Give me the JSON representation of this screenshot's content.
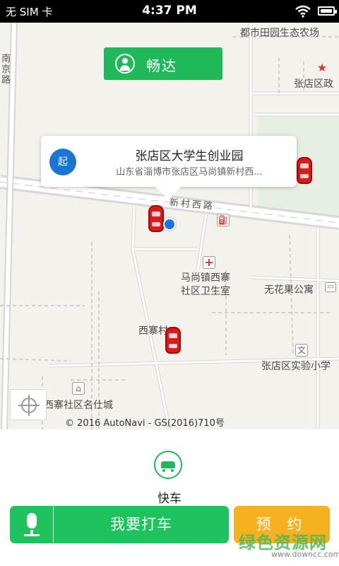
{
  "status_bar": {
    "carrier": "无 SIM 卡",
    "time": "4:37 PM"
  },
  "passenger": {
    "name": "畅达"
  },
  "origin_popup": {
    "badge": "起",
    "title": "张店区大学生创业园",
    "address": "山东省淄博市张店区马尚镇新村西..."
  },
  "map": {
    "labels": {
      "farm": "都市田园生态农场",
      "gov": "张店区政",
      "nanjing_road": "南\n京\n路",
      "xincun_road": "新村西路",
      "clinic_line1": "马尚镇西寨",
      "clinic_line2": "社区卫生室",
      "apartment": "无花果公寓",
      "xizhai": "西寨村",
      "school": "张店区实验小学",
      "community": "西寨社区名仕城"
    },
    "copyright": "© 2016 AutoNavi - GS(2016)710号"
  },
  "service": {
    "label": "快车",
    "icon": "car-icon"
  },
  "actions": {
    "call_taxi": "我要打车",
    "reserve": "预 约"
  },
  "watermark": {
    "logo": "绿色资源网",
    "url": "www.downcc.com"
  },
  "colors": {
    "primary_green": "#1fc35e",
    "reserve_orange": "#f5b120",
    "origin_badge": "#1976d2",
    "map_bg": "#f4f2ec"
  }
}
